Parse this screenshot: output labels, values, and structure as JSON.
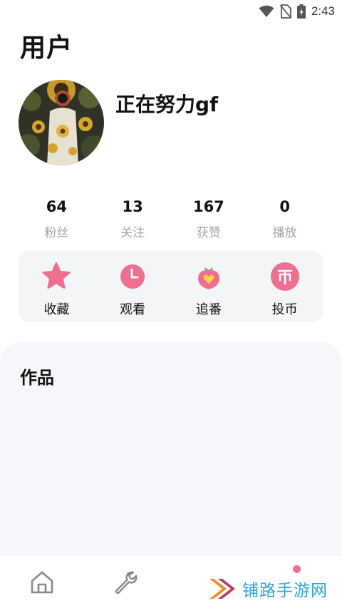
{
  "status_bar": {
    "time": "2:43"
  },
  "header": {
    "title": "用户"
  },
  "profile": {
    "username": "正在努力gf"
  },
  "stats": [
    {
      "value": "64",
      "label": "粉丝"
    },
    {
      "value": "13",
      "label": "关注"
    },
    {
      "value": "167",
      "label": "获赞"
    },
    {
      "value": "0",
      "label": "播放"
    }
  ],
  "actions": [
    {
      "label": "收藏",
      "icon": "star-icon"
    },
    {
      "label": "观看",
      "icon": "clock-icon"
    },
    {
      "label": "追番",
      "icon": "strawberry-heart-icon"
    },
    {
      "label": "投币",
      "icon": "coin-icon"
    }
  ],
  "works": {
    "title": "作品"
  },
  "bottom_nav": {
    "items": [
      "home-icon",
      "wrench-icon",
      "profile-icon"
    ]
  },
  "watermark": {
    "text": "铺路手游网"
  },
  "colors": {
    "accent_pink": "#ee6f8f",
    "card_bg": "#f4f5f7",
    "watermark_blue": "#2da5d8"
  }
}
